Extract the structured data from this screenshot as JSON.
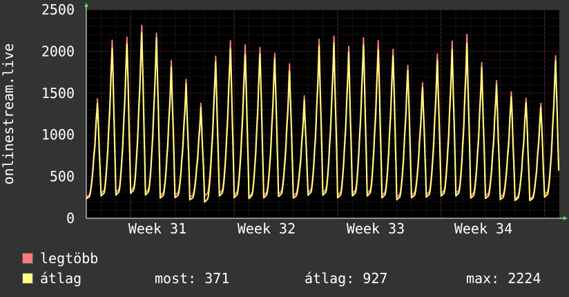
{
  "chart_data": {
    "type": "line",
    "ylabel": "onlinestream.live",
    "ylim": [
      0,
      2500
    ],
    "yticks": [
      0,
      500,
      1000,
      1500,
      2000,
      2500
    ],
    "week_labels": [
      "Week 31",
      "Week 32",
      "Week 33",
      "Week 34"
    ],
    "grid": true,
    "series": [
      {
        "name": "legtöbb",
        "color": "#ff7b7b",
        "peaks": [
          1450,
          2160,
          2190,
          2320,
          2210,
          1870,
          1640,
          1360,
          1940,
          2140,
          2100,
          2070,
          1990,
          1850,
          1450,
          2120,
          2160,
          2050,
          2170,
          2150,
          2050,
          1850,
          1630,
          1960,
          2100,
          2180,
          1850,
          1650,
          1530,
          1460,
          1400,
          1960
        ],
        "troughs": [
          230,
          260,
          270,
          290,
          270,
          240,
          250,
          230,
          230,
          260,
          240,
          220,
          240,
          260,
          250,
          270,
          270,
          240,
          260,
          260,
          240,
          220,
          250,
          250,
          260,
          260,
          240,
          240,
          230,
          210,
          210,
          250
        ]
      },
      {
        "name": "átlag",
        "color": "#ffff80",
        "peaks": [
          1390,
          2060,
          2110,
          2230,
          2150,
          1790,
          1590,
          1310,
          1870,
          2040,
          1980,
          1990,
          1930,
          1760,
          1400,
          2040,
          2080,
          1980,
          2080,
          2040,
          1970,
          1790,
          1570,
          1880,
          2000,
          2070,
          1790,
          1600,
          1470,
          1410,
          1350,
          1900
        ],
        "troughs": [
          210,
          230,
          240,
          260,
          240,
          210,
          220,
          200,
          160,
          230,
          210,
          200,
          210,
          230,
          220,
          240,
          240,
          210,
          230,
          230,
          210,
          190,
          220,
          220,
          230,
          230,
          210,
          210,
          200,
          190,
          190,
          220
        ]
      }
    ],
    "stats": {
      "most": "371",
      "atlag": "927",
      "max": "2224"
    }
  },
  "legend": {
    "max_label": "legtöbb",
    "avg_label": "átlag",
    "most_text": "most: 371",
    "atlag_text": "átlag: 927",
    "max_text": "max: 2224"
  }
}
